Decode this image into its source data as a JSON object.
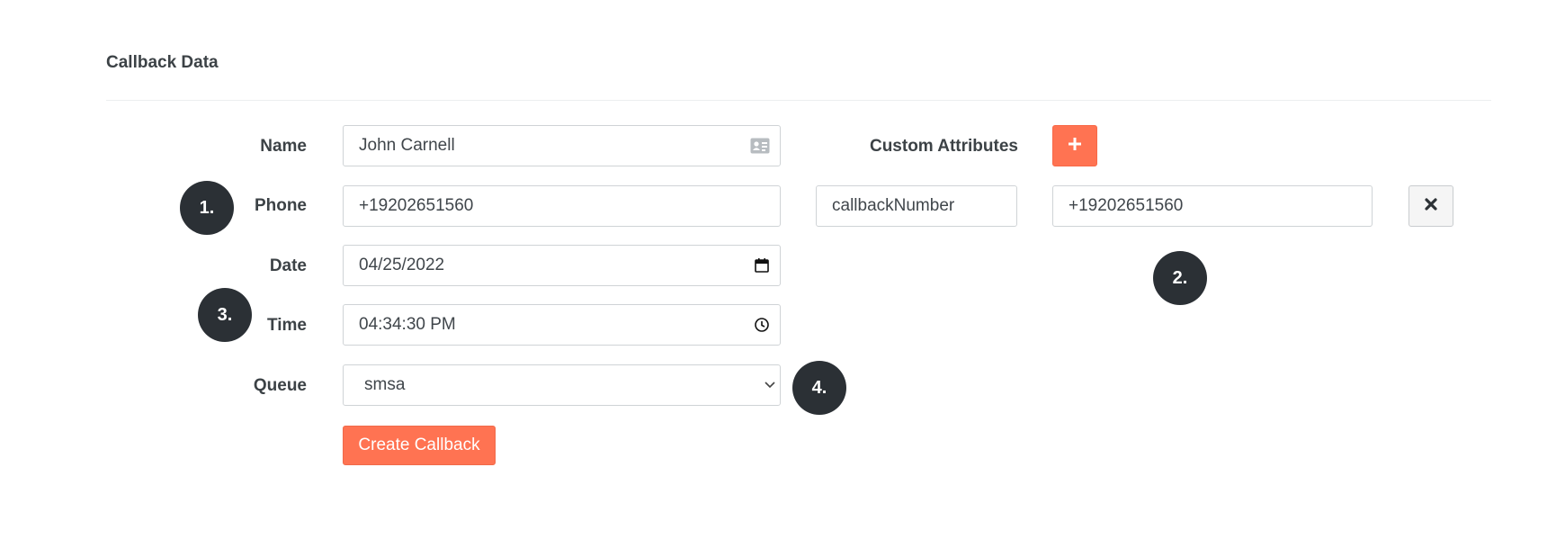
{
  "section": {
    "title": "Callback Data"
  },
  "form": {
    "name": {
      "label": "Name",
      "value": "John Carnell",
      "icon": "contact-card-icon"
    },
    "phone": {
      "label": "Phone",
      "value": "+19202651560"
    },
    "date": {
      "label": "Date",
      "value": "04/25/2022",
      "icon": "calendar-icon"
    },
    "time": {
      "label": "Time",
      "value": "04:34:30 PM",
      "icon": "clock-icon"
    },
    "queue": {
      "label": "Queue",
      "value": "smsa",
      "icon": "chevron-down-icon"
    },
    "create_button": "Create Callback"
  },
  "custom_attributes": {
    "label": "Custom Attributes",
    "add_icon": "plus-icon",
    "items": [
      {
        "key": "callbackNumber",
        "value": "+19202651560",
        "remove_icon": "close-icon"
      }
    ]
  },
  "annotations": [
    "1.",
    "2.",
    "3.",
    "4."
  ],
  "colors": {
    "accent": "#ff7352",
    "badge": "#2b3035",
    "text": "#3c4246"
  }
}
